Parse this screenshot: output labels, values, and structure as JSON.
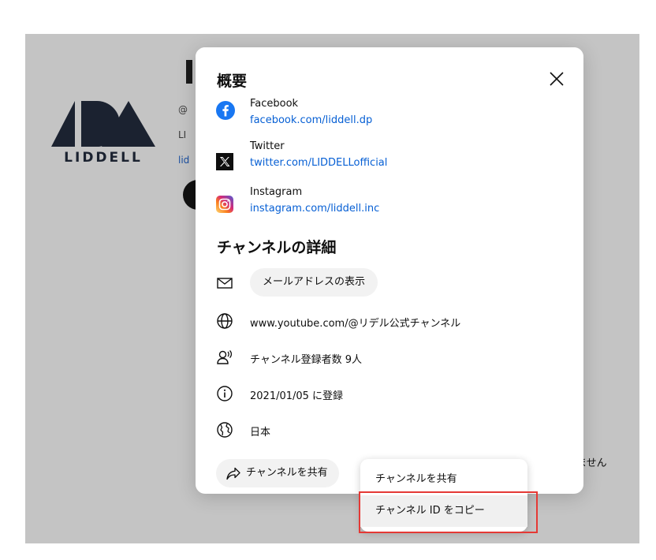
{
  "background": {
    "logo_text": "LIDDELL",
    "frag_at": "@",
    "frag_li": "LI",
    "frag_lid": "lid",
    "side_text": "ません"
  },
  "dialog": {
    "title": "概要",
    "close_icon": "close-icon",
    "links": [
      {
        "name": "Facebook",
        "url": "facebook.com/liddell.dp",
        "icon": "facebook-icon"
      },
      {
        "name": "Twitter",
        "url": "twitter.com/LIDDELLofficial",
        "icon": "x-icon"
      },
      {
        "name": "Instagram",
        "url": "instagram.com/liddell.inc",
        "icon": "instagram-icon"
      }
    ],
    "details_title": "チャンネルの詳細",
    "details": {
      "email_button": "メールアドレスの表示",
      "url": "www.youtube.com/@リデル公式チャンネル",
      "subscribers": "チャンネル登録者数 9人",
      "joined": "2021/01/05 に登録",
      "country": "日本"
    },
    "share_button": "チャンネルを共有"
  },
  "popup": {
    "items": [
      {
        "label": "チャンネルを共有"
      },
      {
        "label": "チャンネル ID をコピー"
      }
    ]
  },
  "colors": {
    "link": "#065fd4",
    "highlight": "#e53935",
    "overlay": "#c4c4c4",
    "facebook": "#1877f2"
  }
}
